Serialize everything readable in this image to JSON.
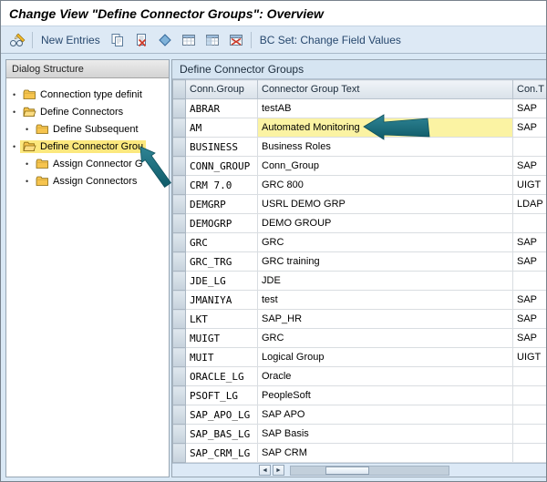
{
  "window": {
    "title": "Change View \"Define Connector Groups\": Overview"
  },
  "toolbar": {
    "new_entries": "New Entries",
    "bc_set": "BC Set: Change Field Values",
    "icons": [
      "display-change-icon",
      "copy-as-icon",
      "delete-entry-icon",
      "undo-change-icon",
      "select-all-icon",
      "select-block-icon",
      "deselect-all-icon"
    ]
  },
  "dialog_structure": {
    "header": "Dialog Structure",
    "bullet": "•",
    "items": [
      {
        "label": "Connection type definit",
        "level": 0,
        "folder": "closed",
        "selected": false
      },
      {
        "label": "Define Connectors",
        "level": 0,
        "folder": "open",
        "selected": false
      },
      {
        "label": "Define Subsequent",
        "level": 1,
        "folder": "closed",
        "selected": false
      },
      {
        "label": "Define Connector Grou",
        "level": 0,
        "folder": "open",
        "selected": true
      },
      {
        "label": "Assign Connector G",
        "level": 1,
        "folder": "closed",
        "selected": false
      },
      {
        "label": "Assign Connectors",
        "level": 1,
        "folder": "closed",
        "selected": false
      }
    ]
  },
  "content": {
    "panel_title": "Define Connector Groups",
    "columns": [
      "Conn.Group",
      "Connector Group Text",
      "Con.T"
    ],
    "rows": [
      {
        "group": "ABRAR",
        "text": "testAB",
        "type": "SAP",
        "highlight": false
      },
      {
        "group": "AM",
        "text": "Automated Monitoring",
        "type": "SAP",
        "highlight": true
      },
      {
        "group": "BUSINESS",
        "text": "Business Roles",
        "type": "",
        "highlight": false
      },
      {
        "group": "CONN_GROUP",
        "text": "Conn_Group",
        "type": "SAP",
        "highlight": false
      },
      {
        "group": "CRM 7.0",
        "text": "GRC 800",
        "type": "UIGT",
        "highlight": false
      },
      {
        "group": "DEMGRP",
        "text": "USRL DEMO GRP",
        "type": "LDAP",
        "highlight": false
      },
      {
        "group": "DEMOGRP",
        "text": "DEMO GROUP",
        "type": "",
        "highlight": false
      },
      {
        "group": "GRC",
        "text": "GRC",
        "type": "SAP",
        "highlight": false
      },
      {
        "group": "GRC_TRG",
        "text": "GRC training",
        "type": "SAP",
        "highlight": false
      },
      {
        "group": "JDE_LG",
        "text": "JDE",
        "type": "",
        "highlight": false
      },
      {
        "group": "JMANIYA",
        "text": "test",
        "type": "SAP",
        "highlight": false
      },
      {
        "group": "LKT",
        "text": "SAP_HR",
        "type": "SAP",
        "highlight": false
      },
      {
        "group": "MUIGT",
        "text": "GRC",
        "type": "SAP",
        "highlight": false
      },
      {
        "group": "MUIT",
        "text": "Logical Group",
        "type": "UIGT",
        "highlight": false
      },
      {
        "group": "ORACLE_LG",
        "text": "Oracle",
        "type": "",
        "highlight": false
      },
      {
        "group": "PSOFT_LG",
        "text": "PeopleSoft",
        "type": "",
        "highlight": false
      },
      {
        "group": "SAP_APO_LG",
        "text": "SAP APO",
        "type": "",
        "highlight": false
      },
      {
        "group": "SAP_BAS_LG",
        "text": "SAP Basis",
        "type": "",
        "highlight": false
      },
      {
        "group": "SAP_CRM_LG",
        "text": "SAP CRM",
        "type": "",
        "highlight": false
      }
    ]
  },
  "scrollbar": {
    "left_arrow": "◄",
    "right_arrow": "►"
  },
  "annotations": [
    {
      "type": "arrow",
      "points_to": "automated-monitoring-cell"
    },
    {
      "type": "arrow",
      "points_to": "tree-item-define-connector-grou"
    }
  ],
  "colors": {
    "arrow_light": "#2f8495",
    "arrow_dark": "#0f5b68",
    "highlight_yellow": "#fbf3a3",
    "highlight_border_red": "#bc4a41",
    "tree_selected_yellow": "#fce87e"
  }
}
